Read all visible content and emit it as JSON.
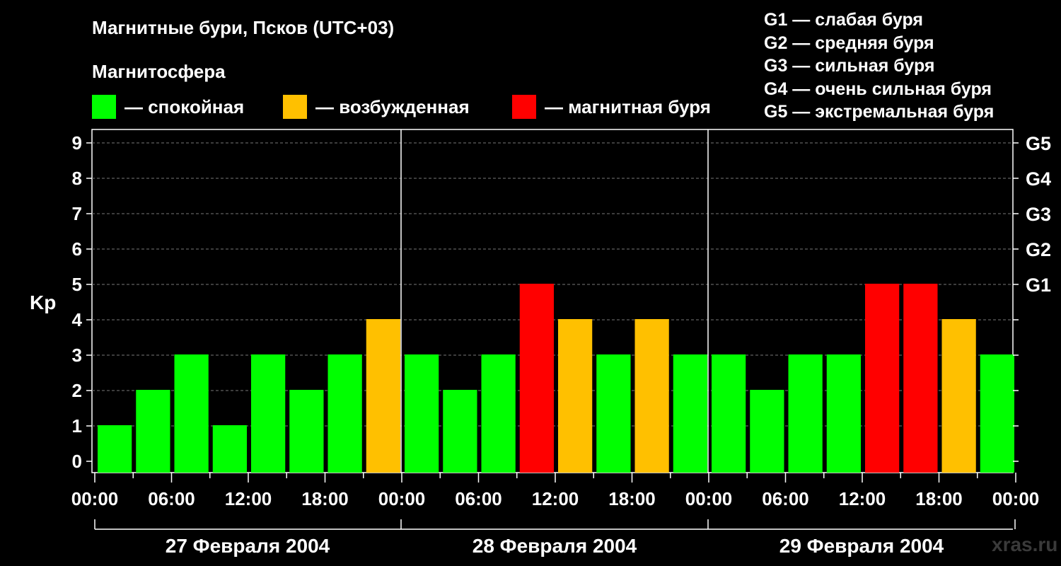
{
  "chart_data": {
    "type": "bar",
    "title": "Магнитные бури, Псков (UTC+03)",
    "subtitle": "Магнитосфера",
    "ylabel": "Kp",
    "ylim": [
      0,
      9
    ],
    "y_ticks": [
      "0",
      "1",
      "2",
      "3",
      "4",
      "5",
      "6",
      "7",
      "8",
      "9"
    ],
    "g_levels": [
      {
        "kp": 5,
        "label": "G1"
      },
      {
        "kp": 6,
        "label": "G2"
      },
      {
        "kp": 7,
        "label": "G3"
      },
      {
        "kp": 8,
        "label": "G4"
      },
      {
        "kp": 9,
        "label": "G5"
      }
    ],
    "x_tick_labels": [
      "00:00",
      "06:00",
      "12:00",
      "18:00",
      "00:00",
      "06:00",
      "12:00",
      "18:00",
      "00:00",
      "06:00",
      "12:00",
      "18:00",
      "00:00"
    ],
    "days": [
      "27 Февраля 2004",
      "28 Февраля 2004",
      "29 Февраля 2004"
    ],
    "values": [
      1,
      2,
      3,
      1,
      3,
      2,
      3,
      4,
      3,
      2,
      3,
      5,
      4,
      3,
      4,
      3,
      3,
      2,
      3,
      3,
      5,
      5,
      4,
      3
    ],
    "grid": "dashed horizontal",
    "legend": [
      {
        "label": "— спокойная",
        "color": "#00ff00"
      },
      {
        "label": "— возбужденная",
        "color": "#ffc000"
      },
      {
        "label": "— магнитная буря",
        "color": "#ff0000"
      }
    ],
    "g_scale_notes": [
      "G1 — слабая буря",
      "G2 — средняя буря",
      "G3 — сильная буря",
      "G4 — очень сильная буря",
      "G5 — экстремальная буря"
    ]
  },
  "watermark": "xras.ru"
}
